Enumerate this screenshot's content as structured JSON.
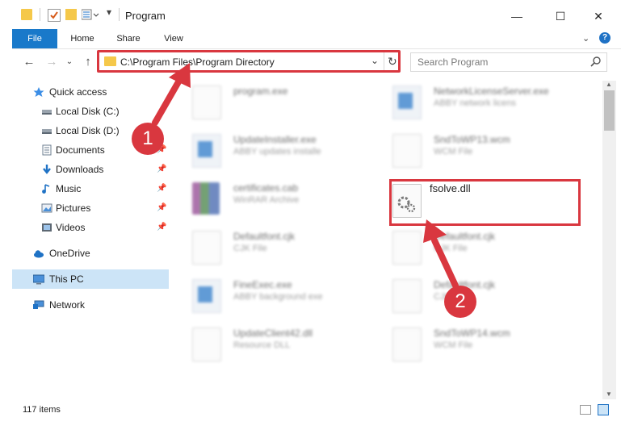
{
  "window": {
    "title": "Program",
    "controls": [
      "—",
      "☐",
      "✕"
    ]
  },
  "ribbon": {
    "tabs": [
      "File",
      "Home",
      "Share",
      "View"
    ]
  },
  "address": {
    "path": "C:\\Program Files\\Program Directory"
  },
  "search": {
    "placeholder": "Search Program"
  },
  "sidebar": {
    "items": [
      {
        "label": "Quick access",
        "icon": "star-icon"
      },
      {
        "label": "Local Disk (C:)",
        "icon": "drive-icon"
      },
      {
        "label": "Local Disk (D:)",
        "icon": "drive-icon"
      },
      {
        "label": "Documents",
        "icon": "documents-icon"
      },
      {
        "label": "Downloads",
        "icon": "download-icon"
      },
      {
        "label": "Music",
        "icon": "music-icon"
      },
      {
        "label": "Pictures",
        "icon": "pictures-icon"
      },
      {
        "label": "Videos",
        "icon": "videos-icon"
      },
      {
        "label": "OneDrive",
        "icon": "cloud-icon"
      },
      {
        "label": "This PC",
        "icon": "computer-icon"
      },
      {
        "label": "Network",
        "icon": "network-icon"
      }
    ]
  },
  "files": [
    {
      "name": "program.exe",
      "desc": ""
    },
    {
      "name": "NetworkLicenseServer.exe",
      "desc": "ABBY network licens"
    },
    {
      "name": "UpdateInstaller.exe",
      "desc": "ABBY updates installe"
    },
    {
      "name": "SndToWP13.wcm",
      "desc": "WCM File"
    },
    {
      "name": "certificates.cab",
      "desc": "WinRAR Archive"
    },
    {
      "name": "fsolve.dll",
      "desc": ""
    },
    {
      "name": "Defaultfont.cjk",
      "desc": "CJK File"
    },
    {
      "name": "Defaultfont.cjk",
      "desc": "CJK File"
    },
    {
      "name": "FineExec.exe",
      "desc": "ABBY background exe"
    },
    {
      "name": "Defaultfont.cjk",
      "desc": "CJK File"
    },
    {
      "name": "UpdateClient42.dll",
      "desc": "Resource DLL"
    },
    {
      "name": "SndToWP14.wcm",
      "desc": "WCM File"
    }
  ],
  "status": {
    "item_count": "117 items"
  },
  "annotations": {
    "step1": "1",
    "step2": "2",
    "color": "#d9373f"
  }
}
